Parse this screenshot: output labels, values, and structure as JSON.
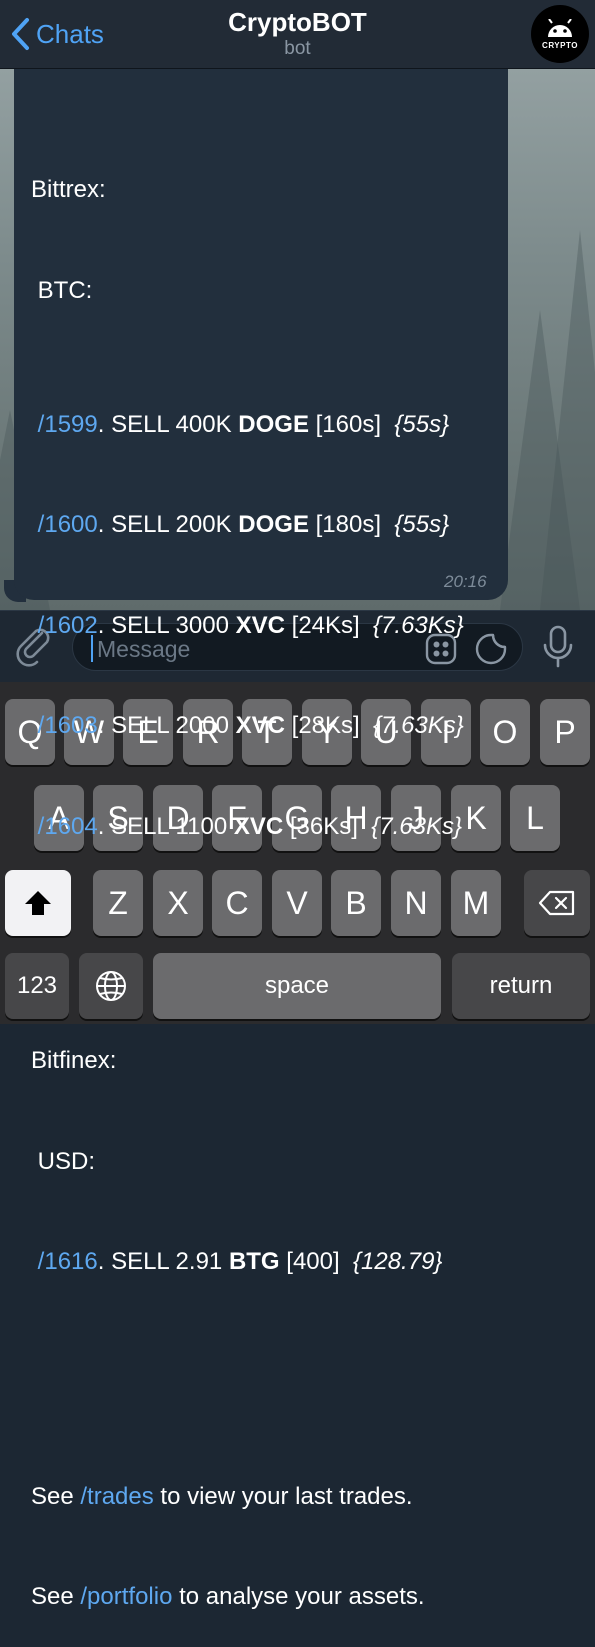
{
  "header": {
    "back_label": "Chats",
    "title": "CryptoBOT",
    "subtitle": "bot",
    "avatar_text": "CRYPTO"
  },
  "message": {
    "exchange1": "Bittrex:",
    "market1": "BTC:",
    "trades1": [
      {
        "cmd": "/1599",
        "action": ". SELL 400K ",
        "coin": "DOGE",
        "rest": " [160s]  ",
        "detail": "{55s}"
      },
      {
        "cmd": "/1600",
        "action": ". SELL 200K ",
        "coin": "DOGE",
        "rest": " [180s]  ",
        "detail": "{55s}"
      },
      {
        "cmd": "/1602",
        "action": ". SELL 3000 ",
        "coin": "XVC",
        "rest": " [24Ks]  ",
        "detail": "{7.63Ks}"
      },
      {
        "cmd": "/1603",
        "action": ". SELL 2000 ",
        "coin": "XVC",
        "rest": " [28Ks]  ",
        "detail": "{7.63Ks}"
      },
      {
        "cmd": "/1604",
        "action": ". SELL 1100 ",
        "coin": "XVC",
        "rest": " [36Ks]  ",
        "detail": "{7.63Ks}"
      }
    ],
    "exchange2": "Bitfinex:",
    "market2": "USD:",
    "trades2": [
      {
        "cmd": "/1616",
        "action": ". SELL 2.91 ",
        "coin": "BTG",
        "rest": " [400]  ",
        "detail": "{128.79}"
      }
    ],
    "see1_prefix": "See ",
    "see1_cmd": "/trades",
    "see1_suffix": " to view your last trades.",
    "see2_prefix": "See ",
    "see2_cmd": "/portfolio",
    "see2_suffix": " to analyse your assets.",
    "time": "20:16"
  },
  "input": {
    "placeholder": "Message"
  },
  "keyboard": {
    "row1": [
      "Q",
      "W",
      "E",
      "R",
      "T",
      "Y",
      "U",
      "I",
      "O",
      "P"
    ],
    "row2": [
      "A",
      "S",
      "D",
      "F",
      "G",
      "H",
      "J",
      "K",
      "L"
    ],
    "row3": [
      "Z",
      "X",
      "C",
      "V",
      "B",
      "N",
      "M"
    ],
    "numbers": "123",
    "space": "space",
    "return": "return"
  }
}
